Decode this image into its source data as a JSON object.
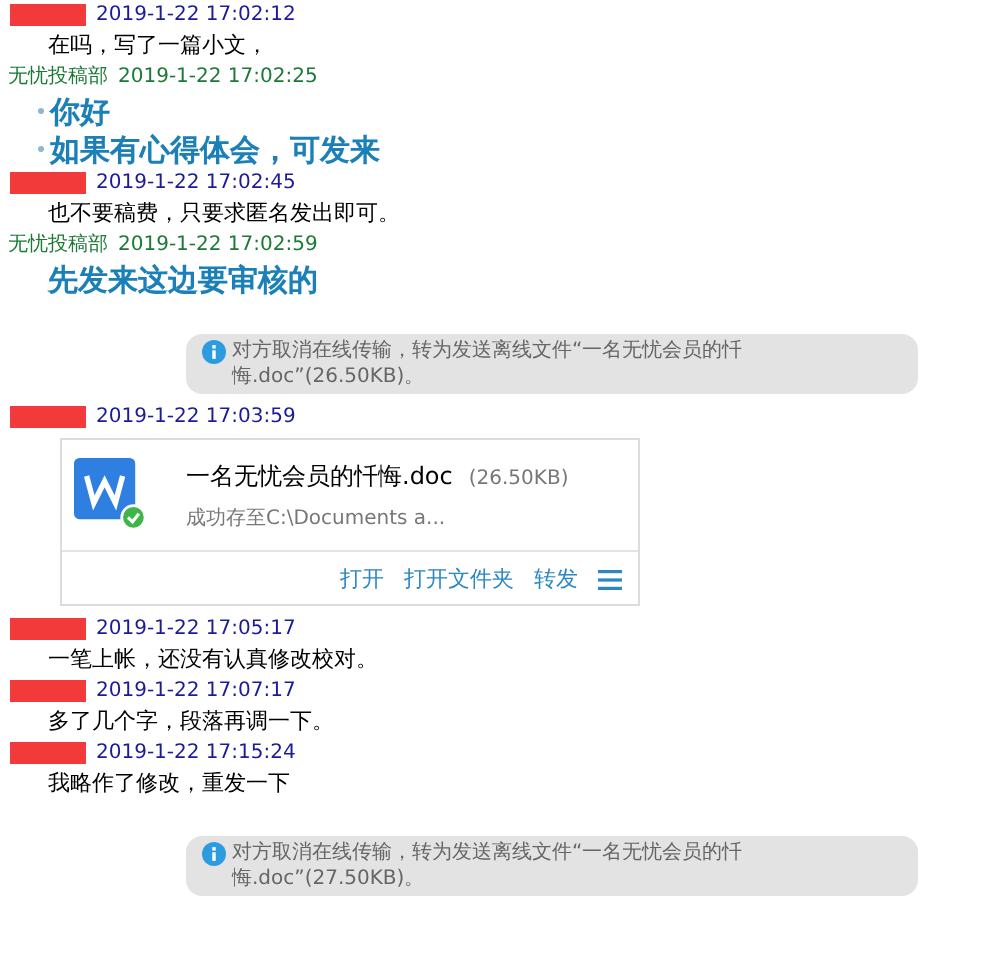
{
  "messages": [
    {
      "kind": "sent",
      "time": "2019-1-22 17:02:12",
      "lines": [
        {
          "text": "在吗，写了一篇小文，",
          "kind": "plain"
        }
      ]
    },
    {
      "kind": "received",
      "sender": "无忧投稿部",
      "time": "2019-1-22 17:02:25",
      "lines": [
        {
          "text": "你好",
          "kind": "bullet"
        },
        {
          "text": "如果有心得体会，可发来",
          "kind": "bullet"
        }
      ]
    },
    {
      "kind": "sent",
      "time": "2019-1-22 17:02:45",
      "lines": [
        {
          "text": "也不要稿费，只要求匿名发出即可。",
          "kind": "plain"
        }
      ]
    },
    {
      "kind": "received",
      "sender": "无忧投稿部",
      "time": "2019-1-22 17:02:59",
      "lines": [
        {
          "text": "先发来这边要审核的",
          "kind": "emphasis"
        }
      ]
    },
    {
      "kind": "notice",
      "text": "对方取消在线传输，转为发送离线文件“一名无忧会员的忏悔.doc”(26.50KB)。"
    },
    {
      "kind": "file",
      "time": "2019-1-22 17:03:59",
      "file_name": "一名无忧会员的忏悔.doc",
      "size": "(26.50KB)",
      "status": "成功存至C:\\Documents a...",
      "actions": [
        "打开",
        "打开文件夹",
        "转发"
      ]
    },
    {
      "kind": "sent",
      "time": "2019-1-22 17:05:17",
      "lines": [
        {
          "text": "一笔上帐，还没有认真修改校对。",
          "kind": "plain"
        }
      ]
    },
    {
      "kind": "sent",
      "time": "2019-1-22 17:07:17",
      "lines": [
        {
          "text": "多了几个字，段落再调一下。",
          "kind": "plain"
        }
      ]
    },
    {
      "kind": "sent",
      "time": "2019-1-22 17:15:24",
      "lines": [
        {
          "text": "我略作了修改，重发一下",
          "kind": "plain"
        }
      ]
    },
    {
      "kind": "notice",
      "text": "对方取消在线传输，转为发送离线文件“一名无忧会员的忏悔.doc”(27.50KB)。"
    }
  ]
}
